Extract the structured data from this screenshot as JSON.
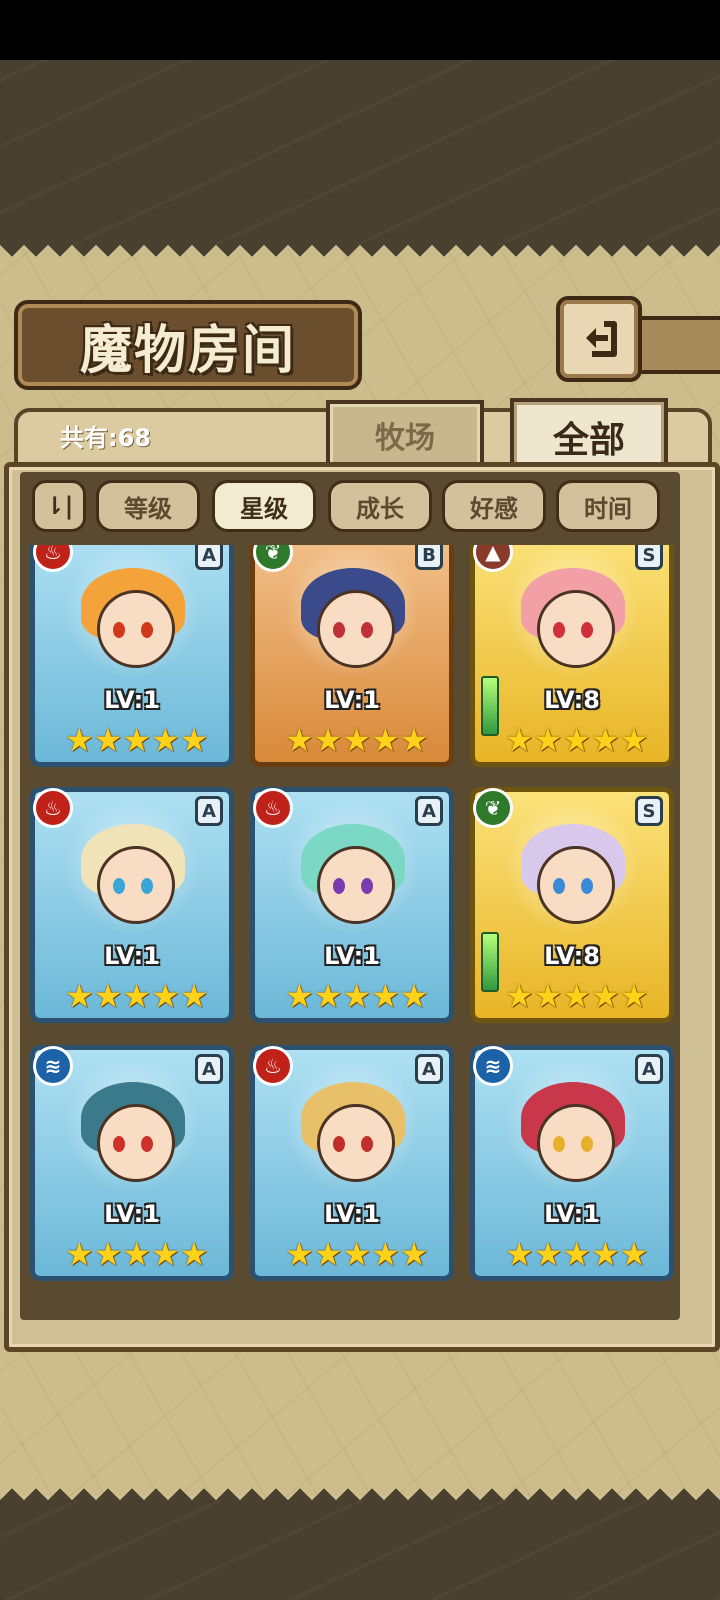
{
  "header": {
    "title": "魔物房间",
    "count_label": "共有:68"
  },
  "tabs": [
    {
      "label": "牧场",
      "active": false
    },
    {
      "label": "全部",
      "active": true
    }
  ],
  "sort": {
    "toggle_icon": "⇂|",
    "buttons": [
      {
        "label": "等级",
        "active": false
      },
      {
        "label": "星级",
        "active": true
      },
      {
        "label": "成长",
        "active": false
      },
      {
        "label": "好感",
        "active": false
      },
      {
        "label": "时间",
        "active": false
      }
    ]
  },
  "monsters": [
    {
      "rank": "A",
      "element": "fire",
      "element_icon": "flame-icon",
      "level": "LV:1",
      "stars": 5,
      "hair": "#f3a33a",
      "eye": "#d03a1a"
    },
    {
      "rank": "B",
      "element": "grass",
      "element_icon": "leaf-icon",
      "level": "LV:1",
      "stars": 5,
      "hair": "#3a4a8a",
      "eye": "#c0303a"
    },
    {
      "rank": "S",
      "element": "earth",
      "element_icon": "mountain-icon",
      "level": "LV:8",
      "stars": 5,
      "hair": "#f2a0a6",
      "eye": "#d0303a",
      "weapon": true
    },
    {
      "rank": "A",
      "element": "fire",
      "element_icon": "flame-icon",
      "level": "LV:1",
      "stars": 5,
      "hair": "#f1e3b8",
      "eye": "#3aa6d8"
    },
    {
      "rank": "A",
      "element": "fire",
      "element_icon": "flame-icon",
      "level": "LV:1",
      "stars": 5,
      "hair": "#7ad8c4",
      "eye": "#7a3ab0"
    },
    {
      "rank": "S",
      "element": "grass",
      "element_icon": "leaf-icon",
      "level": "LV:8",
      "stars": 5,
      "hair": "#d8c8ec",
      "eye": "#3a8ad8",
      "weapon": true
    },
    {
      "rank": "A",
      "element": "water",
      "element_icon": "water-wave-icon",
      "level": "LV:1",
      "stars": 5,
      "hair": "#3a7a8a",
      "eye": "#d0302a"
    },
    {
      "rank": "A",
      "element": "fire",
      "element_icon": "flame-icon",
      "level": "LV:1",
      "stars": 5,
      "hair": "#e8c06a",
      "eye": "#c0302a"
    },
    {
      "rank": "A",
      "element": "water",
      "element_icon": "water-wave-icon",
      "level": "LV:1",
      "stars": 5,
      "hair": "#c8384a",
      "eye": "#e8b02a"
    }
  ],
  "colors": {
    "fire": "#c0221a",
    "grass": "#2e7a2a",
    "earth": "#8a3a2a",
    "water": "#1b62a8"
  }
}
